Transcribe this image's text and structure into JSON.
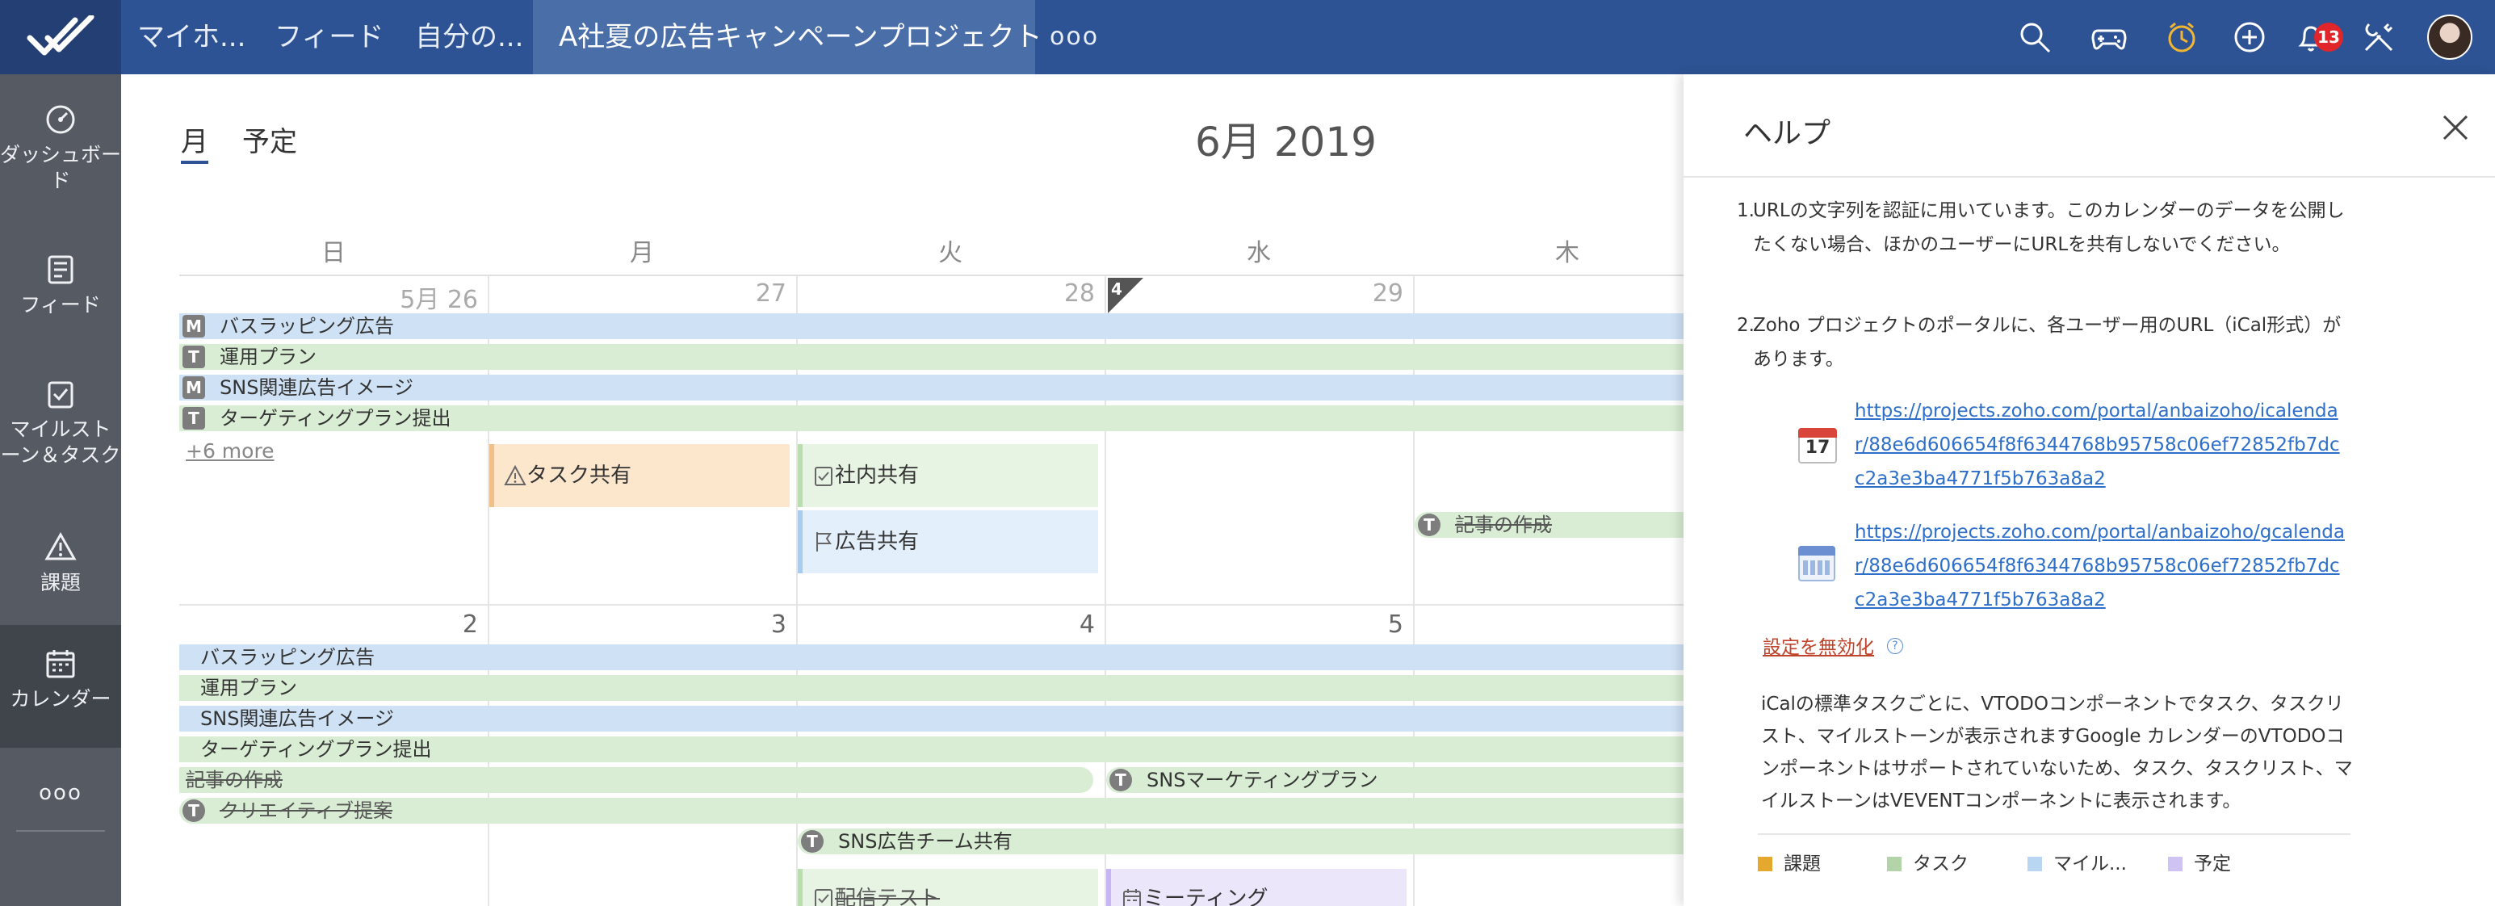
{
  "top_nav": {
    "tabs": [
      "マイホ...",
      "フィード",
      "自分の..."
    ],
    "project": "A社夏の広告キャンペーンプロジェクト",
    "more": "ooo",
    "notification_count": "13"
  },
  "sidebar": {
    "items": [
      {
        "label": "ダッシュボード",
        "icon": "dashboard-icon"
      },
      {
        "label": "フィード",
        "icon": "feed-icon"
      },
      {
        "label": "マイルストーン＆タスク",
        "icon": "milestone-task-icon"
      },
      {
        "label": "課題",
        "icon": "issue-icon"
      },
      {
        "label": "カレンダー",
        "icon": "calendar-icon"
      }
    ],
    "more": "ooo"
  },
  "calendar": {
    "view_tabs": [
      "月",
      "予定"
    ],
    "title": "6月 2019",
    "weekdays": [
      "日",
      "月",
      "火",
      "水",
      "木"
    ],
    "week1": {
      "dates": [
        "5月 26",
        "27",
        "28",
        "29"
      ],
      "week_number": "4",
      "bars": [
        {
          "tag": "M",
          "label": "バスラッピング広告"
        },
        {
          "tag": "T",
          "label": "運用プラン"
        },
        {
          "tag": "M",
          "label": "SNS関連広告イメージ"
        },
        {
          "tag": "T",
          "label": "ターゲティングプラン提出"
        }
      ],
      "more_link": "+6 more",
      "cards": [
        {
          "label": "タスク共有"
        },
        {
          "label": "社内共有"
        },
        {
          "label": "広告共有"
        }
      ],
      "strike_bar": {
        "tag": "T",
        "label": "記事の作成"
      }
    },
    "week2": {
      "dates": [
        "2",
        "3",
        "4",
        "5"
      ],
      "bars": [
        {
          "label": "バスラッピング広告"
        },
        {
          "label": "運用プラン"
        },
        {
          "label": "SNS関連広告イメージ"
        },
        {
          "label": "ターゲティングプラン提出"
        }
      ],
      "strike1": {
        "label": "記事の作成"
      },
      "sns_plan": {
        "tag": "T",
        "label": "SNSマーケティングプラン"
      },
      "strike2": {
        "tag": "T",
        "label": "クリエイティブ提案"
      },
      "sns_team": {
        "tag": "T",
        "label": "SNS広告チーム共有"
      },
      "card_delivery": {
        "label": "配信テスト"
      },
      "card_meeting": {
        "label": "ミーティング"
      }
    }
  },
  "help": {
    "title": "ヘルプ",
    "p1_num": "1.",
    "p1": "URLの文字列を認証に用いています。このカレンダーのデータを公開したくない場合、ほかのユーザーにURLを共有しないでください。",
    "p2_num": "2.",
    "p2": "Zoho プロジェクトのポータルに、各ユーザー用のURL（iCal形式）があります。",
    "ical_day": "17",
    "link1": "https://projects.zoho.com/portal/anbaizoho/icalendar/88e6d606654f8f6344768b95758c06ef72852fb7dcc2a3e3ba4771f5b763a8a2",
    "link2": "https://projects.zoho.com/portal/anbaizoho/gcalendar/88e6d606654f8f6344768b95758c06ef72852fb7dcc2a3e3ba4771f5b763a8a2",
    "disable": "設定を無効化",
    "qmark": "?",
    "ical_note": "iCalの標準タスクごとに、VTODOコンポーネントでタスク、タスクリスト、マイルストーンが表示されますGoogle カレンダーのVTODOコンポーネントはサポートされていないため、タスク、タスクリスト、マイルストーンはVEVENTコンポーネントに表示されます。",
    "legend": [
      {
        "label": "課題",
        "color": "#e5a82e"
      },
      {
        "label": "タスク",
        "color": "#b2d4a8"
      },
      {
        "label": "マイル...",
        "color": "#b8d6f2"
      },
      {
        "label": "予定",
        "color": "#cfc3f3"
      }
    ]
  }
}
